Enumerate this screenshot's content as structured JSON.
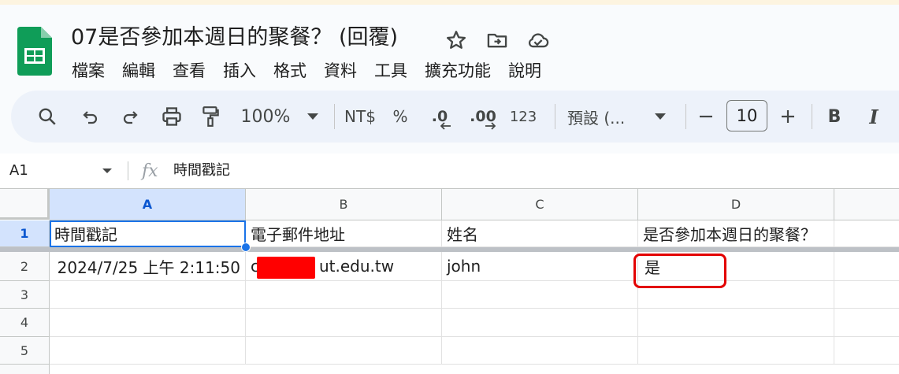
{
  "document": {
    "title": "07是否參加本週日的聚餐？ (回覆)"
  },
  "title_icons": [
    "star-icon",
    "move-to-folder-icon",
    "cloud-saved-icon"
  ],
  "menu": {
    "items": [
      "檔案",
      "編輯",
      "查看",
      "插入",
      "格式",
      "資料",
      "工具",
      "擴充功能",
      "說明"
    ]
  },
  "toolbar": {
    "zoom": "100%",
    "currency": "NT$",
    "percent": "%",
    "decrease_decimal": ".0",
    "increase_decimal": ".00",
    "number_format": "123",
    "font": "預設 (...",
    "font_size": "10",
    "bold": "B",
    "italic": "I"
  },
  "formula_bar": {
    "cell_ref": "A1",
    "content": "時間戳記"
  },
  "sheet": {
    "columns": [
      "A",
      "B",
      "C",
      "D"
    ],
    "rows": [
      "1",
      "2",
      "3",
      "4",
      "5"
    ],
    "header_row": [
      "時間戳記",
      "電子郵件地址",
      "姓名",
      "是否參加本週日的聚餐？"
    ],
    "row2": {
      "timestamp": "2024/7/25 上午 2:11:50",
      "email_prefix": "c",
      "email_suffix": "ut.edu.tw",
      "name": "john",
      "answer": "是"
    }
  },
  "colors": {
    "accent": "#1a73e8",
    "header_bg": "#f9fbfd",
    "toolbar_bg": "#edf2fa",
    "selected_header": "#d3e3fd",
    "annotation_red": "#e30000",
    "redaction": "#ff0000",
    "sheets_green": "#0f9d58"
  }
}
